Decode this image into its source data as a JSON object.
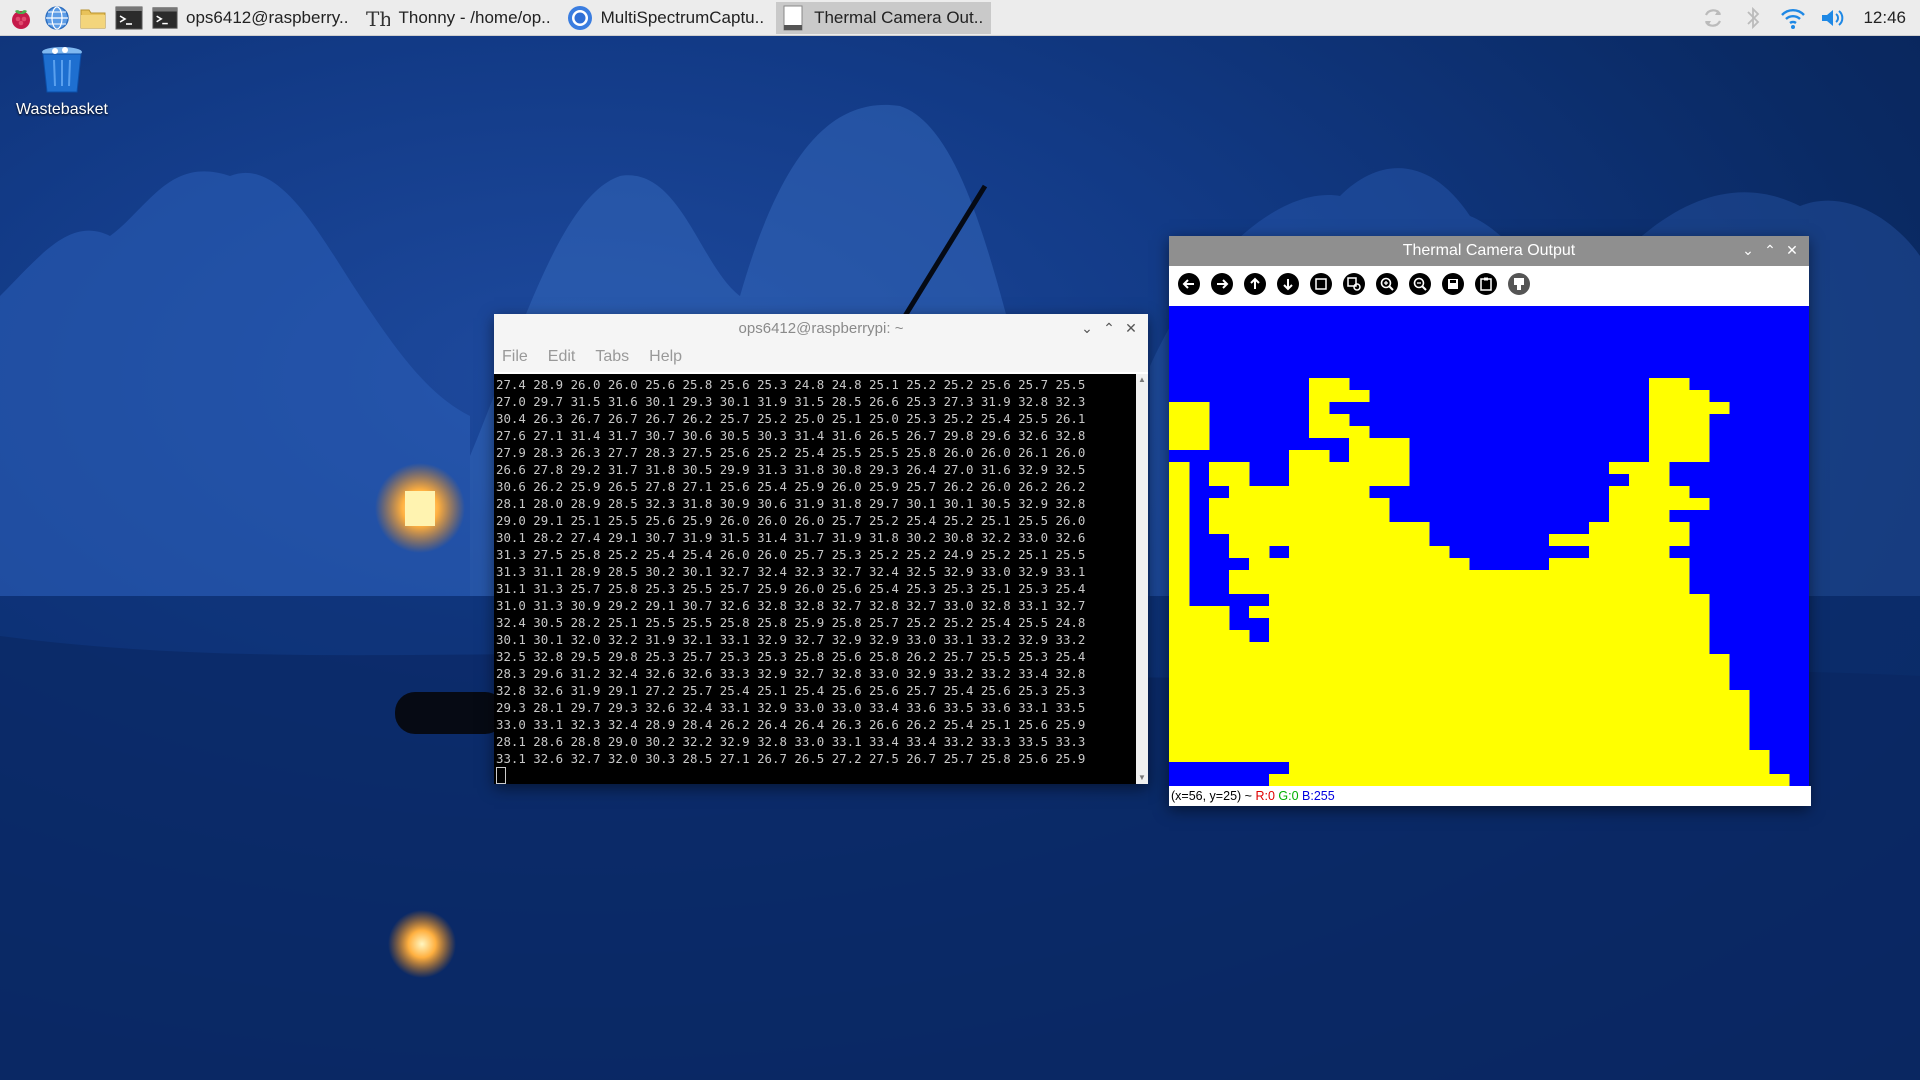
{
  "taskbar": {
    "launchers": [
      "raspberry-menu-icon",
      "web-browser-icon",
      "file-manager-icon",
      "terminal-icon"
    ],
    "tasks": [
      {
        "label": "ops6412@raspberry..",
        "icon": "terminal-icon",
        "active": false
      },
      {
        "label": "Thonny  -  /home/op..",
        "icon": "thonny-icon",
        "active": false
      },
      {
        "label": "MultiSpectrumCaptu..",
        "icon": "chromium-icon",
        "active": false
      },
      {
        "label": "Thermal Camera Out..",
        "icon": "image-viewer-icon",
        "active": true
      }
    ],
    "tray": [
      "update-icon",
      "bluetooth-icon",
      "wifi-icon",
      "volume-icon"
    ],
    "clock": "12:46"
  },
  "desktop": {
    "icons": [
      {
        "label": "Wastebasket",
        "icon": "trash-icon"
      }
    ]
  },
  "terminal": {
    "title": "ops6412@raspberrypi: ~",
    "menu": [
      "File",
      "Edit",
      "Tabs",
      "Help"
    ],
    "lines": [
      "27.4 28.9 26.0 26.0 25.6 25.8 25.6 25.3 24.8 24.8 25.1 25.2 25.2 25.6 25.7 25.5",
      "27.0 29.7 31.5 31.6 30.1 29.3 30.1 31.9 31.5 28.5 26.6 25.3 27.3 31.9 32.8 32.3",
      "30.4 26.3 26.7 26.7 26.7 26.2 25.7 25.2 25.0 25.1 25.0 25.3 25.2 25.4 25.5 26.1",
      "27.6 27.1 31.4 31.7 30.7 30.6 30.5 30.3 31.4 31.6 26.5 26.7 29.8 29.6 32.6 32.8",
      "27.9 28.3 26.3 27.7 28.3 27.5 25.6 25.2 25.4 25.5 25.5 25.8 26.0 26.0 26.1 26.0",
      "26.6 27.8 29.2 31.7 31.8 30.5 29.9 31.3 31.8 30.8 29.3 26.4 27.0 31.6 32.9 32.5",
      "30.6 26.2 25.9 26.5 27.8 27.1 25.6 25.4 25.9 26.0 25.9 25.7 26.2 26.0 26.2 26.2",
      "28.1 28.0 28.9 28.5 32.3 31.8 30.9 30.6 31.9 31.8 29.7 30.1 30.1 30.5 32.9 32.8",
      "29.0 29.1 25.1 25.5 25.6 25.9 26.0 26.0 26.0 25.7 25.2 25.4 25.2 25.1 25.5 26.0",
      "30.1 28.2 27.4 29.1 30.7 31.9 31.5 31.4 31.7 31.9 31.8 30.2 30.8 32.2 33.0 32.6",
      "31.3 27.5 25.8 25.2 25.4 25.4 26.0 26.0 25.7 25.3 25.2 25.2 24.9 25.2 25.1 25.5",
      "31.3 31.1 28.9 28.5 30.2 30.1 32.7 32.4 32.3 32.7 32.4 32.5 32.9 33.0 32.9 33.1",
      "31.1 31.3 25.7 25.8 25.3 25.5 25.7 25.9 26.0 25.6 25.4 25.3 25.3 25.1 25.3 25.4",
      "31.0 31.3 30.9 29.2 29.1 30.7 32.6 32.8 32.8 32.7 32.8 32.7 33.0 32.8 33.1 32.7",
      "32.4 30.5 28.2 25.1 25.5 25.5 25.8 25.8 25.9 25.8 25.7 25.2 25.2 25.4 25.5 24.8",
      "30.1 30.1 32.0 32.2 31.9 32.1 33.1 32.9 32.7 32.9 32.9 33.0 33.1 33.2 32.9 33.2",
      "32.5 32.8 29.5 29.8 25.3 25.7 25.3 25.3 25.8 25.6 25.8 26.2 25.7 25.5 25.3 25.4",
      "28.3 29.6 31.2 32.4 32.6 32.6 33.3 32.9 32.7 32.8 33.0 32.9 33.2 33.2 33.4 32.8",
      "32.8 32.6 31.9 29.1 27.2 25.7 25.4 25.1 25.4 25.6 25.6 25.7 25.4 25.6 25.3 25.3",
      "29.3 28.1 29.7 29.3 32.6 32.4 33.1 32.9 33.0 33.0 33.4 33.6 33.5 33.6 33.1 33.5",
      "33.0 33.1 32.3 32.4 28.9 28.4 26.2 26.4 26.4 26.3 26.6 26.2 25.4 25.1 25.6 25.9",
      "28.1 28.6 28.8 29.0 30.2 32.2 32.9 32.8 33.0 33.1 33.4 33.4 33.2 33.3 33.5 33.3",
      "33.1 32.6 32.7 32.0 30.3 28.5 27.1 26.7 26.5 27.2 27.5 26.7 25.7 25.8 25.6 25.9"
    ]
  },
  "thermal": {
    "title": "Thermal Camera Output",
    "toolbar": [
      "back-arrow-icon",
      "forward-arrow-icon",
      "up-arrow-icon",
      "down-arrow-icon",
      "fit-image-icon",
      "reset-zoom-icon",
      "zoom-in-icon",
      "zoom-out-icon",
      "save-icon",
      "clipboard-icon",
      "settings-icon"
    ],
    "status": {
      "coords": "(x=56, y=25) ~",
      "r": "R:0",
      "g": "G:0",
      "b": "B:255"
    },
    "colors": {
      "cold": "#0000ff",
      "hot": "#ffff00"
    },
    "mask": [
      "00000000000000000000000000000000",
      "00000000000000000000000000000000",
      "00000000000000000000000000000000",
      "00000000000000000000000000000000",
      "00000000000000000000000000000000",
      "00000000000000000000000000000000",
      "00000001100000000000000011000000",
      "00000001110000000000000011100000",
      "11000001000000000000000011110000",
      "11000001100000000000000011100000",
      "11000001110000000000000011100000",
      "11000000011100000000000011100000",
      "00000011011100000000000011100000",
      "10110011111100000000001110000000",
      "10110011111100000000000110000000",
      "10011111110000000000001111000000",
      "10111111111000000000001111100000",
      "10111111111000000000001110000000",
      "10111111111110000000011111000000",
      "10011111111110000001111111000000",
      "10011011111111000000011110000000",
      "10001111111111100001111111000000",
      "10011111111111111111111111000000",
      "10011111111111111111111111000000",
      "10000111111111111111111111100000",
      "11101111111111111111111111100000",
      "11100111111111111111111111100000",
      "11110111111111111111111111100000",
      "11111111111111111111111111100000",
      "11111111111111111111111111110000",
      "11111111111111111111111111110000",
      "11111111111111111111111111110000",
      "11111111111111111111111111111000",
      "11111111111111111111111111111000",
      "11111111111111111111111111111000",
      "11111111111111111111111111111000",
      "11111111111111111111111111111000",
      "11111111111111111111111111111100",
      "00000011111111111111111111111100",
      "00000111111111111111111111111110"
    ]
  }
}
